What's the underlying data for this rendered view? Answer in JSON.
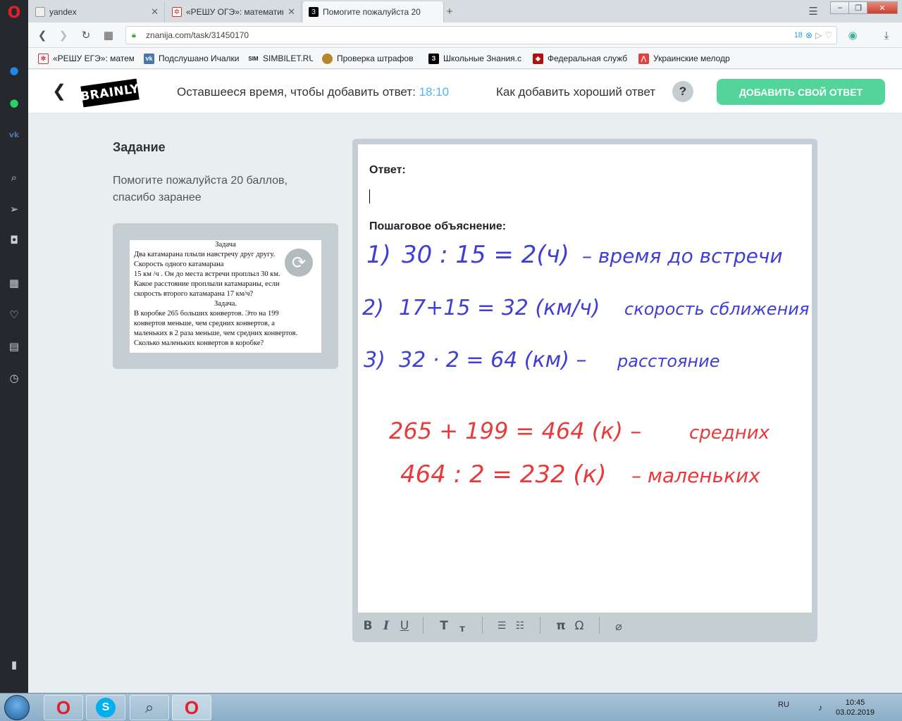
{
  "browser": {
    "tabs": [
      {
        "label": "yandex",
        "icon": "document-icon"
      },
      {
        "label": "«РЕШУ ОГЭ»: математика",
        "icon": "reshu-icon"
      },
      {
        "label": "Помогите пожалуйста 20",
        "icon": "znanija-icon"
      }
    ],
    "url": "znanija.com/task/31450170",
    "adblock_count": "18",
    "bookmarks": [
      "«РЕШУ ЕГЭ»: матема",
      "Подслушано Ичалки",
      "SIMBILET.RU",
      "Проверка штрафов",
      "Школьные Знания.c",
      "Федеральная служб",
      "Украинские мелодр"
    ]
  },
  "header": {
    "logo": "BRAINLY",
    "timer_label": "Оставшееся время, чтобы добавить ответ:",
    "timer_value": "18:10",
    "howto": "Как добавить хороший ответ",
    "help": "?",
    "add_button": "ДОБАВИТЬ СВОЙ ОТВЕТ"
  },
  "task": {
    "title": "Задание",
    "text": "Помогите пожалуйста 20 баллов, спасибо заранее",
    "image_lines": [
      {
        "text": "Задача",
        "center": true
      },
      {
        "text": "Два катамарана плыли навстречу друг другу.",
        "center": false
      },
      {
        "text": "Скорость одного катамарана",
        "center": false
      },
      {
        "text": "15 км /ч . Он до места встречи проплыл 30 км.",
        "center": false
      },
      {
        "text": "Какое расстояние проплыли катамараны, если",
        "center": false
      },
      {
        "text": "скорость второго катамарана 17 км/ч?",
        "center": false
      },
      {
        "text": "Задача.",
        "center": true
      },
      {
        "text": "В коробке 265 больших конвертов. Это на 199",
        "center": false
      },
      {
        "text": "конвертов меньше, чем средних конвертов, а",
        "center": false
      },
      {
        "text": "маленьких в 2 раза меньше, чем средних конвертов.",
        "center": false
      },
      {
        "text": "Сколько маленьких конвертов в коробке?",
        "center": false
      }
    ]
  },
  "editor": {
    "answer_label": "Ответ:",
    "explanation_label": "Пошаговое объяснение:",
    "handwriting": {
      "blue_color": "#3f3fd6",
      "red_color": "#e83a3a",
      "lines": [
        {
          "num": "1)",
          "expr": "30 : 15 = 2(ч)",
          "note": "– время до встречи"
        },
        {
          "num": "2)",
          "expr": "17+15 = 32 (км/ч)",
          "note": "скорость сближения"
        },
        {
          "num": "3)",
          "expr": "32 · 2 = 64 (км) –",
          "note": "расстояние"
        },
        {
          "num": "",
          "expr": "265 + 199 = 464 (к) –",
          "note": "средних"
        },
        {
          "num": "",
          "expr": "464 : 2 = 232 (к)",
          "note": "– маленьких"
        }
      ]
    },
    "toolbar": [
      "B",
      "I",
      "U",
      "T",
      "т",
      "list-numbered",
      "list-bullet",
      "π",
      "Ω",
      "attach"
    ]
  },
  "taskbar": {
    "lang": "RU",
    "time": "10:45",
    "date": "03.02.2019"
  }
}
